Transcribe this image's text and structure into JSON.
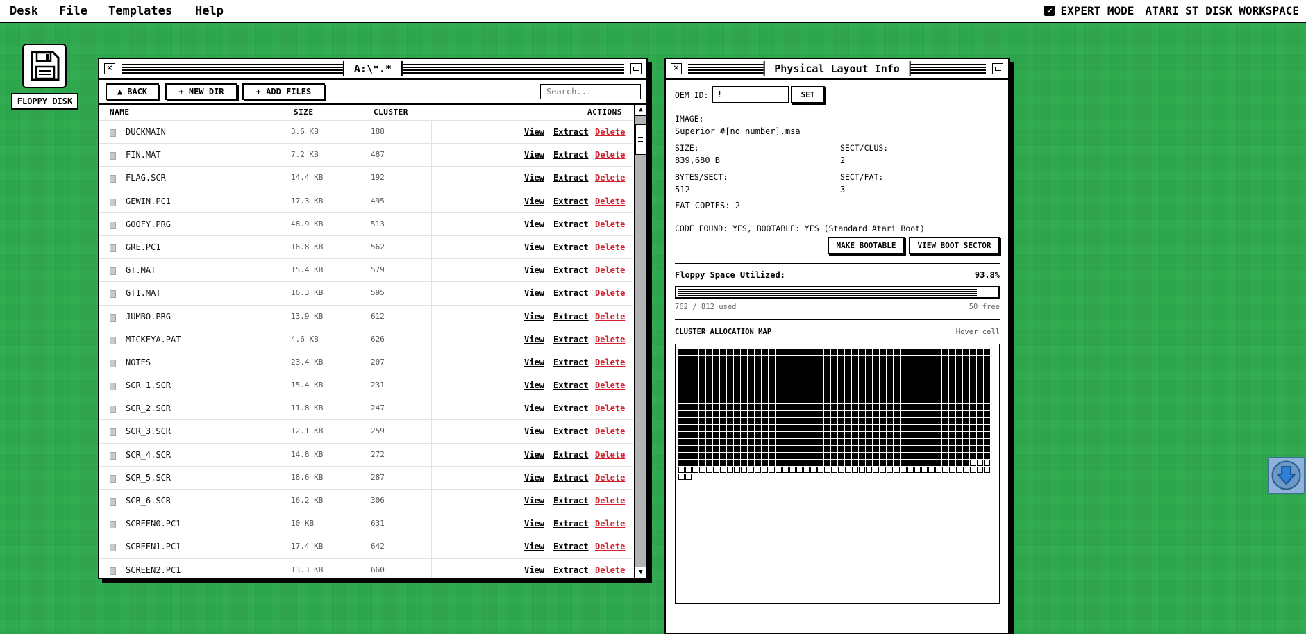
{
  "menubar": {
    "items": [
      "Desk",
      "File",
      "Templates",
      "Help"
    ],
    "expert_mode_label": "EXPERT MODE",
    "expert_mode_checked": true,
    "workspace_title": "ATARI ST DISK WORKSPACE"
  },
  "desktop": {
    "icon_label": "FLOPPY DISK",
    "icon_name": "floppy-disk-icon"
  },
  "file_window": {
    "title": "A:\\*.*",
    "back_label": "▲ BACK",
    "new_dir_label": "+ NEW DIR",
    "add_files_label": "+ ADD FILES",
    "search_placeholder": "Search...",
    "headers": {
      "name": "NAME",
      "size": "SIZE",
      "cluster": "CLUSTER",
      "actions": "ACTIONS"
    },
    "actions": {
      "view": "View",
      "extract": "Extract",
      "delete": "Delete"
    },
    "files": [
      {
        "name": "DUCKMAIN",
        "size": "3.6 KB",
        "cluster": "188"
      },
      {
        "name": "FIN.MAT",
        "size": "7.2 KB",
        "cluster": "487"
      },
      {
        "name": "FLAG.SCR",
        "size": "14.4 KB",
        "cluster": "192"
      },
      {
        "name": "GEWIN.PC1",
        "size": "17.3 KB",
        "cluster": "495"
      },
      {
        "name": "GOOFY.PRG",
        "size": "48.9 KB",
        "cluster": "513"
      },
      {
        "name": "GRE.PC1",
        "size": "16.8 KB",
        "cluster": "562"
      },
      {
        "name": "GT.MAT",
        "size": "15.4 KB",
        "cluster": "579"
      },
      {
        "name": "GT1.MAT",
        "size": "16.3 KB",
        "cluster": "595"
      },
      {
        "name": "JUMBO.PRG",
        "size": "13.9 KB",
        "cluster": "612"
      },
      {
        "name": "MICKEYA.PAT",
        "size": "4.6 KB",
        "cluster": "626"
      },
      {
        "name": "NOTES",
        "size": "23.4 KB",
        "cluster": "207"
      },
      {
        "name": "SCR_1.SCR",
        "size": "15.4 KB",
        "cluster": "231"
      },
      {
        "name": "SCR_2.SCR",
        "size": "11.8 KB",
        "cluster": "247"
      },
      {
        "name": "SCR_3.SCR",
        "size": "12.1 KB",
        "cluster": "259"
      },
      {
        "name": "SCR_4.SCR",
        "size": "14.8 KB",
        "cluster": "272"
      },
      {
        "name": "SCR_5.SCR",
        "size": "18.6 KB",
        "cluster": "287"
      },
      {
        "name": "SCR_6.SCR",
        "size": "16.2 KB",
        "cluster": "306"
      },
      {
        "name": "SCREEN0.PC1",
        "size": "10 KB",
        "cluster": "631"
      },
      {
        "name": "SCREEN1.PC1",
        "size": "17.4 KB",
        "cluster": "642"
      },
      {
        "name": "SCREEN2.PC1",
        "size": "13.3 KB",
        "cluster": "660"
      }
    ]
  },
  "info_window": {
    "title": "Physical Layout Info",
    "oem_label": "OEM ID:",
    "oem_value": "!",
    "set_label": "SET",
    "image_label": "IMAGE:",
    "image_value": "Superior #[no number].msa",
    "size_label": "SIZE:",
    "size_value": "839,680 B",
    "sect_clus_label": "SECT/CLUS:",
    "sect_clus_value": "2",
    "bytes_sect_label": "BYTES/SECT:",
    "bytes_sect_value": "512",
    "sect_fat_label": "SECT/FAT:",
    "sect_fat_value": "3",
    "fat_copies_text": "FAT COPIES: 2",
    "boot_status": "CODE FOUND: YES, BOOTABLE: YES (Standard Atari Boot)",
    "make_bootable_label": "MAKE BOOTABLE",
    "view_boot_sector_label": "VIEW BOOT SECTOR",
    "space_label": "Floppy Space Utilized:",
    "space_percent": "93.8%",
    "space_fraction": 0.938,
    "used_text": "762 / 812 used",
    "free_text": "50 free",
    "map_title": "CLUSTER ALLOCATION MAP",
    "map_hint": "Hover cell",
    "map_total_cells": 812,
    "map_used_cells": 762
  },
  "floating_widget": {
    "icon_name": "download-arrow-icon"
  }
}
